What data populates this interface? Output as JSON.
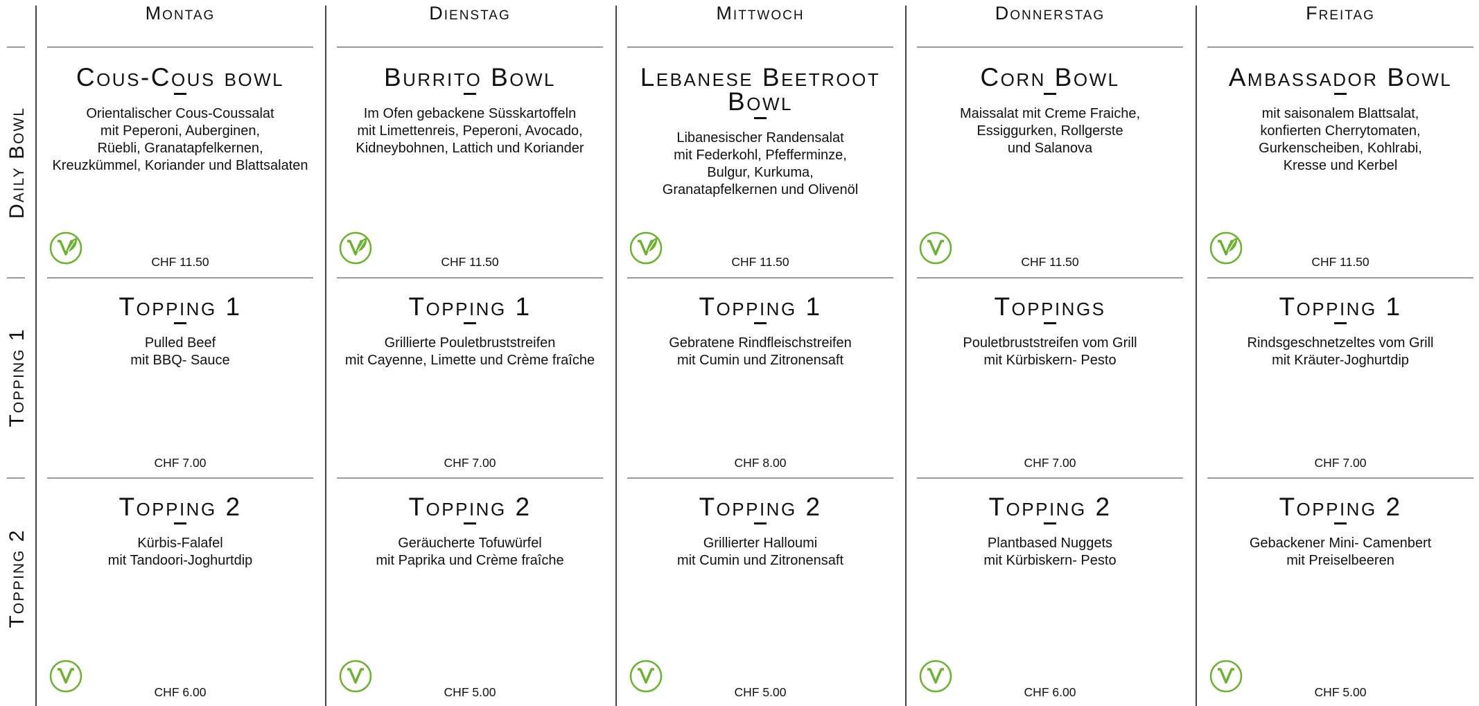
{
  "days": [
    "Montag",
    "Dienstag",
    "Mittwoch",
    "Donnerstag",
    "Freitag"
  ],
  "rows": [
    "Daily Bowl",
    "Topping 1",
    "Topping 2"
  ],
  "theme": {
    "vegan_green": "#6bb32e"
  },
  "menu": [
    {
      "bowl": {
        "title": "Cous-Cous bowl",
        "desc": "Orientalischer Cous-Coussalat\nmit Peperoni, Auberginen,\nRüebli, Granatapfelkernen,\nKreuzkümmel, Koriander und Blattsalaten",
        "price": "CHF 11.50",
        "badge": "vegan-leaf-icon"
      },
      "topping1": {
        "title": "Topping 1",
        "desc": "Pulled Beef\nmit BBQ- Sauce",
        "price": "CHF 7.00",
        "badge": ""
      },
      "topping2": {
        "title": "Topping 2",
        "desc": "Kürbis-Falafel\nmit Tandoori-Joghurtdip",
        "price": "CHF 6.00",
        "badge": "vegetarian-icon"
      }
    },
    {
      "bowl": {
        "title": "Burrito Bowl",
        "desc": "Im Ofen gebackene Süsskartoffeln\nmit Limettenreis, Peperoni, Avocado,\nKidneybohnen, Lattich und Koriander",
        "price": "CHF 11.50",
        "badge": "vegan-leaf-icon"
      },
      "topping1": {
        "title": "Topping 1",
        "desc": "Grillierte Pouletbruststreifen\nmit Cayenne, Limette und Crème fraîche",
        "price": "CHF 7.00",
        "badge": ""
      },
      "topping2": {
        "title": "Topping 2",
        "desc": "Geräucherte Tofuwürfel\nmit Paprika und Crème fraîche",
        "price": "CHF 5.00",
        "badge": "vegetarian-icon"
      }
    },
    {
      "bowl": {
        "title": "Lebanese Beetroot Bowl",
        "desc": "Libanesischer Randensalat\nmit Federkohl, Pfefferminze,\nBulgur, Kurkuma,\nGranatapfelkernen und Olivenöl",
        "price": "CHF 11.50",
        "badge": "vegan-leaf-icon"
      },
      "topping1": {
        "title": "Topping 1",
        "desc": "Gebratene Rindfleischstreifen\nmit Cumin und Zitronensaft",
        "price": "CHF 8.00",
        "badge": ""
      },
      "topping2": {
        "title": "Topping 2",
        "desc": "Grillierter Halloumi\nmit Cumin und Zitronensaft",
        "price": "CHF 5.00",
        "badge": "vegetarian-icon"
      }
    },
    {
      "bowl": {
        "title": "Corn Bowl",
        "desc": "Maissalat mit Creme Fraiche,\nEssiggurken, Rollgerste\nund Salanova",
        "price": "CHF 11.50",
        "badge": "vegetarian-icon"
      },
      "topping1": {
        "title": "Toppings",
        "desc": "Pouletbruststreifen vom Grill\nmit Kürbiskern- Pesto",
        "price": "CHF 7.00",
        "badge": ""
      },
      "topping2": {
        "title": "Topping 2",
        "desc": "Plantbased Nuggets\nmit Kürbiskern- Pesto",
        "price": "CHF 6.00",
        "badge": "vegetarian-icon"
      }
    },
    {
      "bowl": {
        "title": "Ambassador Bowl",
        "desc": "mit saisonalem Blattsalat,\nkonfierten Cherrytomaten,\nGurkenscheiben, Kohlrabi,\nKresse und Kerbel",
        "price": "CHF 11.50",
        "badge": "vegan-leaf-icon"
      },
      "topping1": {
        "title": "Topping 1",
        "desc": "Rindsgeschnetzeltes vom Grill\nmit Kräuter-Joghurtdip",
        "price": "CHF 7.00",
        "badge": ""
      },
      "topping2": {
        "title": "Topping 2",
        "desc": "Gebackener Mini- Camenbert\nmit Preiselbeeren",
        "price": "CHF 5.00",
        "badge": "vegetarian-icon"
      }
    }
  ]
}
